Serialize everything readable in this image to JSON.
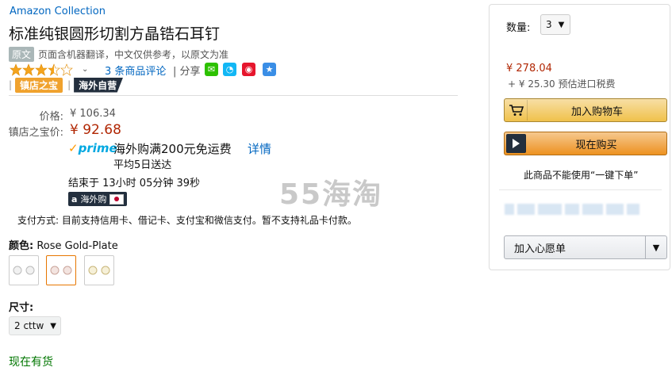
{
  "product": {
    "brand": "Amazon Collection",
    "title": "标准纯银圆形切割方晶锆石耳钉",
    "original_tag": "原文",
    "translation_note": "页面含机器翻译，中文仅供参考，以原文为准",
    "rating": 3.5,
    "review_link": "3 条商品评论",
    "share_label": "| 分享",
    "badges": {
      "sep": "|",
      "store_treasure": "镇店之宝",
      "overseas": "海外自营"
    }
  },
  "pricing": {
    "list_label": "价格:",
    "list_price": "¥ 106.34",
    "deal_label": "镇店之宝价:",
    "deal_price": "¥ 92.68",
    "prime_logo": "prime",
    "prime_text": "海外购满200元免运费",
    "prime_detail": "详情",
    "delivery": "平均5日送达",
    "ends": "结束于 13小时 05分钟 39秒",
    "haiwai_tag": "海外购",
    "payment": "支付方式: 目前支持信用卡、借记卡、支付宝和微信支付。暂不支持礼品卡付款。"
  },
  "watermark": "55海淘",
  "color": {
    "label": "颜色:",
    "value": "Rose Gold-Plate"
  },
  "size": {
    "label": "尺寸:",
    "value": "2 cttw"
  },
  "stock": "现在有货",
  "buybox": {
    "qty_label": "数量:",
    "qty_value": "3",
    "price": "¥ 278.04",
    "tax": "+ ¥ 25.30 预估进口税费",
    "add_to_cart": "加入购物车",
    "buy_now": "现在购买",
    "no_oneclick": "此商品不能使用“一键下单”",
    "wishlist": "加入心愿单"
  },
  "colors": {
    "link": "#0066c0",
    "price": "#b12704",
    "stock": "#007600",
    "star": "#f4a41d"
  }
}
